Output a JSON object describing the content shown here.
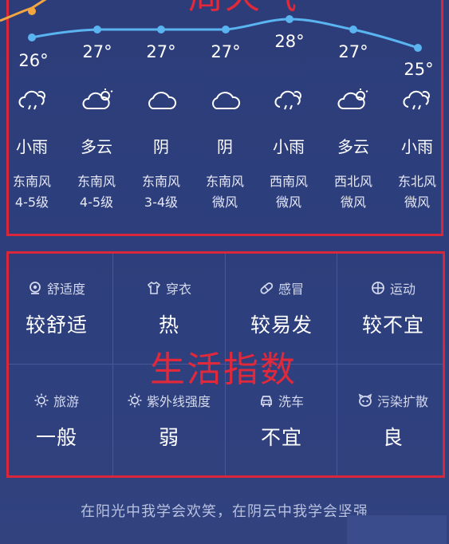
{
  "forecast": {
    "heading": "一周天气",
    "temps": [
      "26°",
      "27°",
      "27°",
      "27°",
      "28°",
      "27°",
      "25°"
    ],
    "conditions": [
      "小雨",
      "多云",
      "阴",
      "阴",
      "小雨",
      "多云",
      "小雨"
    ],
    "icons": [
      "rain-icon",
      "partly-cloudy-icon",
      "cloud-icon",
      "cloud-icon",
      "rain-icon",
      "partly-cloudy-icon",
      "rain-icon"
    ],
    "wind_directions": [
      "东南风",
      "东南风",
      "东南风",
      "东南风",
      "西南风",
      "西北风",
      "东北风"
    ],
    "wind_levels": [
      "4-5级",
      "4-5级",
      "3-4级",
      "微风",
      "微风",
      "微风",
      "微风"
    ],
    "line_color": "#5ab4f0",
    "upper_line_color": "#f2a640"
  },
  "life": {
    "heading": "生活指数",
    "items": [
      {
        "label": "舒适度",
        "value": "较舒适",
        "icon": "comfort-icon"
      },
      {
        "label": "穿衣",
        "value": "热",
        "icon": "shirt-icon"
      },
      {
        "label": "感冒",
        "value": "较易发",
        "icon": "pill-icon"
      },
      {
        "label": "运动",
        "value": "较不宜",
        "icon": "ball-icon"
      },
      {
        "label": "旅游",
        "value": "一般",
        "icon": "sun-icon"
      },
      {
        "label": "紫外线强度",
        "value": "弱",
        "icon": "uv-sun-icon"
      },
      {
        "label": "洗车",
        "value": "不宜",
        "icon": "car-icon"
      },
      {
        "label": "污染扩散",
        "value": "良",
        "icon": "pollution-icon"
      }
    ]
  },
  "footer": {
    "text": "在阳光中我学会欢笑，在阴云中我学会坚强"
  },
  "colors": {
    "background": "#2e3f7d",
    "annotation_red": "#e0293a"
  }
}
